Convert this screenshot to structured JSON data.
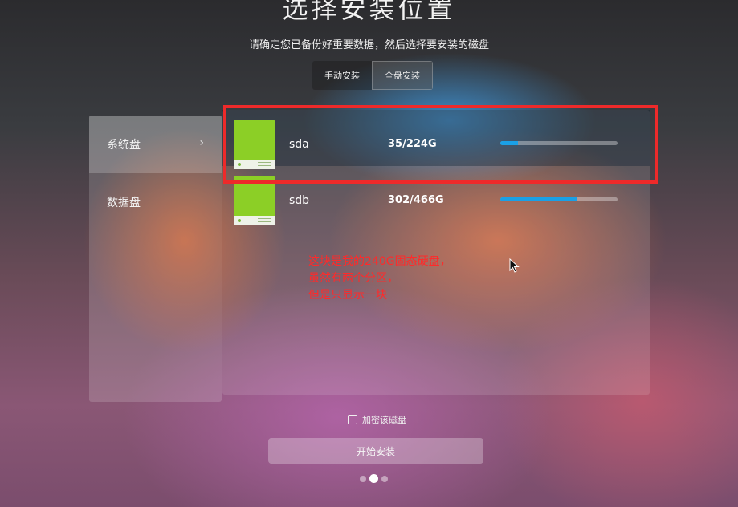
{
  "title": "选择安装位置",
  "subtitle": "请确定您已备份好重要数据，然后选择要安装的磁盘",
  "tabs": [
    {
      "label": "手动安装",
      "active": false
    },
    {
      "label": "全盘安装",
      "active": true
    }
  ],
  "sidebar": {
    "items": [
      {
        "label": "系统盘",
        "active": true,
        "chevron": "›"
      },
      {
        "label": "数据盘",
        "active": false
      }
    ]
  },
  "disks": [
    {
      "name": "sda",
      "size": "35/224G",
      "usage_fraction": 0.15,
      "selected": true
    },
    {
      "name": "sdb",
      "size": "302/466G",
      "usage_fraction": 0.65,
      "selected": false
    }
  ],
  "annotation": {
    "lines": [
      "这块是我的240G固态硬盘，",
      "虽然有两个分区，",
      "但是只显示一块"
    ],
    "color": "#ee2a2a"
  },
  "encrypt": {
    "label": "加密该磁盘",
    "checked": false
  },
  "start_button": {
    "label": "开始安装"
  },
  "pagination": {
    "total": 3,
    "current": 2
  },
  "colors": {
    "accent": "#1aa0e6",
    "disk_icon": "#8ccf26"
  }
}
